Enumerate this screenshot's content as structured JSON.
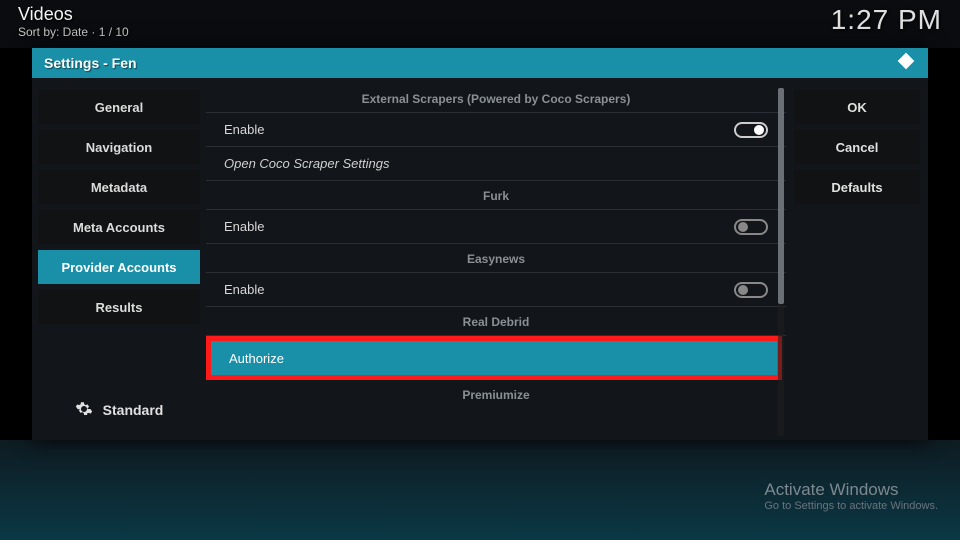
{
  "topbar": {
    "title": "Videos",
    "subtitle": "Sort by: Date  ·  1 / 10",
    "clock": "1:27 PM"
  },
  "window": {
    "title": "Settings - Fen"
  },
  "sidebar": {
    "items": [
      {
        "label": "General",
        "selected": false
      },
      {
        "label": "Navigation",
        "selected": false
      },
      {
        "label": "Metadata",
        "selected": false
      },
      {
        "label": "Meta Accounts",
        "selected": false
      },
      {
        "label": "Provider Accounts",
        "selected": true
      },
      {
        "label": "Results",
        "selected": false
      }
    ],
    "level": "Standard"
  },
  "content": {
    "sections": [
      {
        "header": "External Scrapers (Powered by Coco Scrapers)",
        "rows": [
          {
            "label": "Enable",
            "toggle": "on"
          },
          {
            "label": "Open Coco Scraper Settings",
            "italic": true
          }
        ]
      },
      {
        "header": "Furk",
        "rows": [
          {
            "label": "Enable",
            "toggle": "off"
          }
        ]
      },
      {
        "header": "Easynews",
        "rows": [
          {
            "label": "Enable",
            "toggle": "off"
          }
        ]
      },
      {
        "header": "Real Debrid",
        "rows": [
          {
            "label": "Authorize",
            "highlight": true
          }
        ]
      },
      {
        "header": "Premiumize",
        "rows": []
      }
    ]
  },
  "buttons": {
    "ok": "OK",
    "cancel": "Cancel",
    "defaults": "Defaults"
  },
  "watermark": {
    "line1": "Activate Windows",
    "line2": "Go to Settings to activate Windows."
  }
}
